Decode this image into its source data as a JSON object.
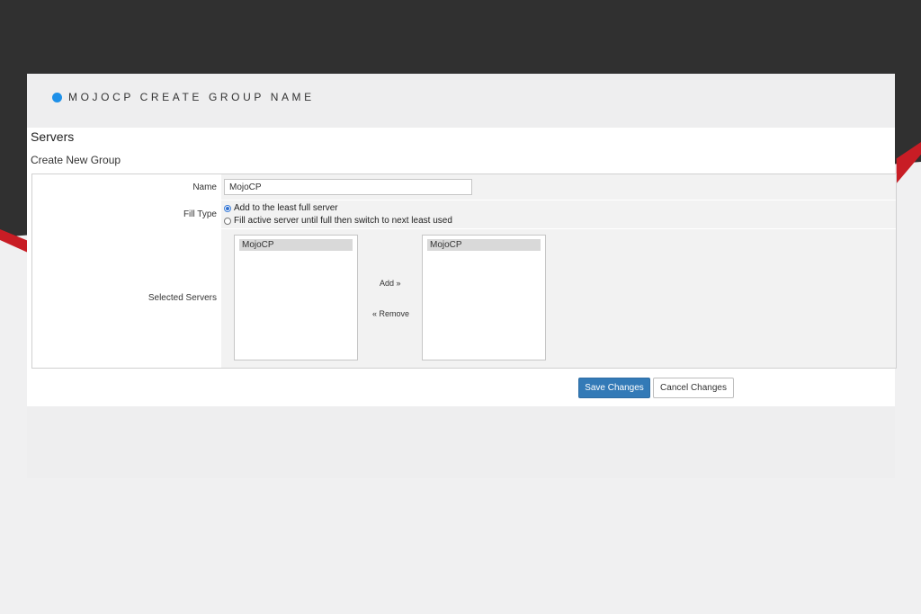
{
  "header": {
    "title": "MOJOCP CREATE GROUP NAME",
    "accent_color": "#1e90e8"
  },
  "page": {
    "section_title": "Servers",
    "subtitle": "Create New Group"
  },
  "form": {
    "name_label": "Name",
    "name_value": "MojoCP",
    "fill_type_label": "Fill Type",
    "fill_options": [
      {
        "label": "Add to the least full server",
        "selected": true
      },
      {
        "label": "Fill active server until full then switch to next least used",
        "selected": false
      }
    ],
    "selected_servers_label": "Selected Servers",
    "available_servers": [
      "MojoCP"
    ],
    "selected_servers": [
      "MojoCP"
    ],
    "add_label": "Add »",
    "remove_label": "« Remove"
  },
  "buttons": {
    "save_label": "Save Changes",
    "cancel_label": "Cancel Changes"
  },
  "colors": {
    "primary_button": "#337ab7",
    "background_dark": "#303030",
    "background_red": "#c81d25"
  }
}
